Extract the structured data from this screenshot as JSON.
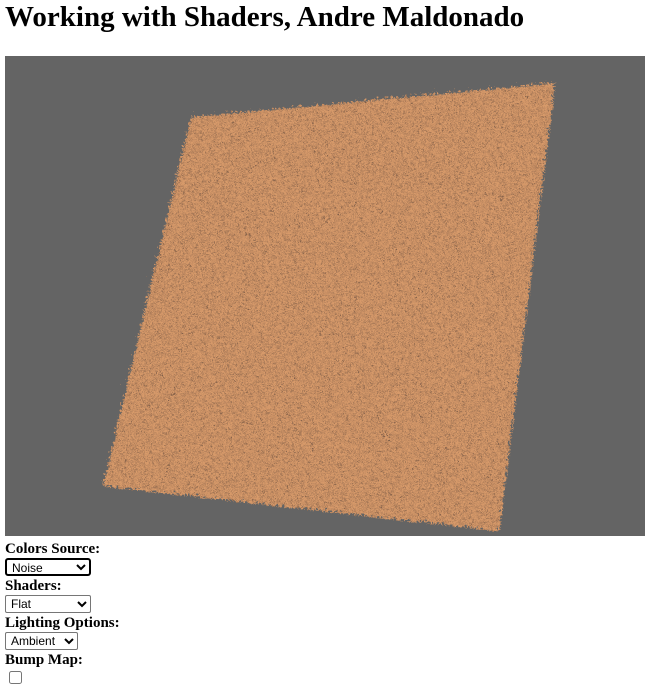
{
  "page": {
    "title": "Working with Shaders, Andre Maldonado"
  },
  "canvas": {
    "background_color": "#646464",
    "surface_base_color": "#a8704a",
    "surface_light_color": "#d79a6a",
    "surface_dark_color": "#1e120c",
    "surface_texture": "noise"
  },
  "controls": {
    "colors_source": {
      "label": "Colors Source:",
      "selected": "Noise"
    },
    "shaders": {
      "label": "Shaders:",
      "selected": "Flat"
    },
    "lighting": {
      "label": "Lighting Options:",
      "selected": "Ambient"
    },
    "bump_map": {
      "label": "Bump Map:",
      "checked": false
    }
  }
}
